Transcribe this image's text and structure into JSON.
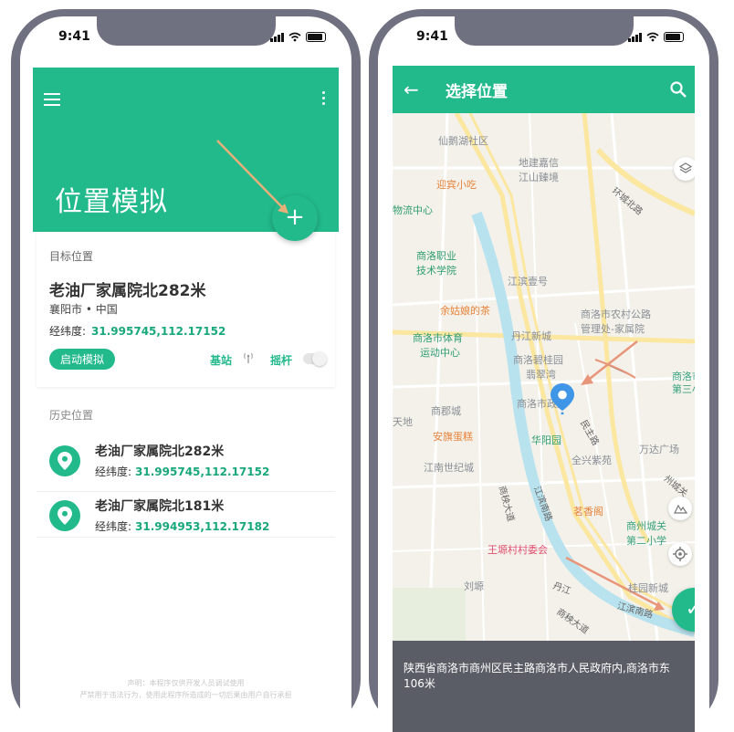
{
  "status_bar": {
    "time": "9:41"
  },
  "main_screen": {
    "title": "位置模拟",
    "add_icon": "+",
    "target": {
      "label": "目标位置",
      "name": "老油厂家属院北282米",
      "region": "襄阳市 • 中国",
      "coord_label": "经纬度:",
      "coord_value": "31.995745,112.17152",
      "start_button": "启动模拟",
      "base_station_label": "基站",
      "joystick_label": "摇杆"
    },
    "history": {
      "label": "历史位置",
      "items": [
        {
          "title": "老油厂家属院北282米",
          "coord_label": "经纬度:",
          "coord_value": "31.995745,112.17152"
        },
        {
          "title": "老油厂家属院北181米",
          "coord_label": "经纬度:",
          "coord_value": "31.994953,112.17182"
        }
      ]
    },
    "footer_lines": [
      "声明：本程序仅供开发人员调试使用",
      "严禁用于违法行为，使用此程序所造成的一切后果由用户自行承担"
    ]
  },
  "map_screen": {
    "title": "选择位置",
    "back_icon": "←",
    "check_icon": "✓",
    "address": "陕西省商洛市商州区民主路商洛市人民政府内,商洛市东106米",
    "pois": {
      "p1": "仙鹅湖社区",
      "p2": "地建嘉信",
      "p2b": "江山臻境",
      "p3": "迎宾小吃",
      "p4": "物流中心",
      "p5": "环城北路",
      "p6": "商洛职业",
      "p6b": "技术学院",
      "p7": "江滨壹号",
      "p8": "余姑娘的茶",
      "p9": "商洛市农村公路",
      "p9b": "管理处-家属院",
      "p10": "商洛市体育",
      "p10b": "运动中心",
      "p11": "丹江新城",
      "p12": "商洛碧桂园",
      "p12b": "翡翠湾",
      "p13": "商洛市",
      "p13b": "第三小学",
      "p14": "商洛市政府",
      "p15": "天地",
      "p16": "商郡城",
      "p17": "安旗蛋糕",
      "p18": "华阳园",
      "p19": "民主路",
      "p20": "万达广场",
      "p21": "全兴紫苑",
      "p22": "江南世纪城",
      "p23": "州城关",
      "p24": "商秧大道",
      "p25": "江滨南路",
      "p26": "茗香阁",
      "p27": "商州城关",
      "p27b": "第二小学",
      "p28": "王塬村村委会",
      "p29": "刘塬",
      "p30": "丹江",
      "p31": "桂园新城",
      "p32": "江滨南路",
      "p33": "商秧大道"
    }
  },
  "colors": {
    "accent": "#22b98b",
    "address_bg": "#5b5d66",
    "phone_frame": "#6f7080"
  }
}
